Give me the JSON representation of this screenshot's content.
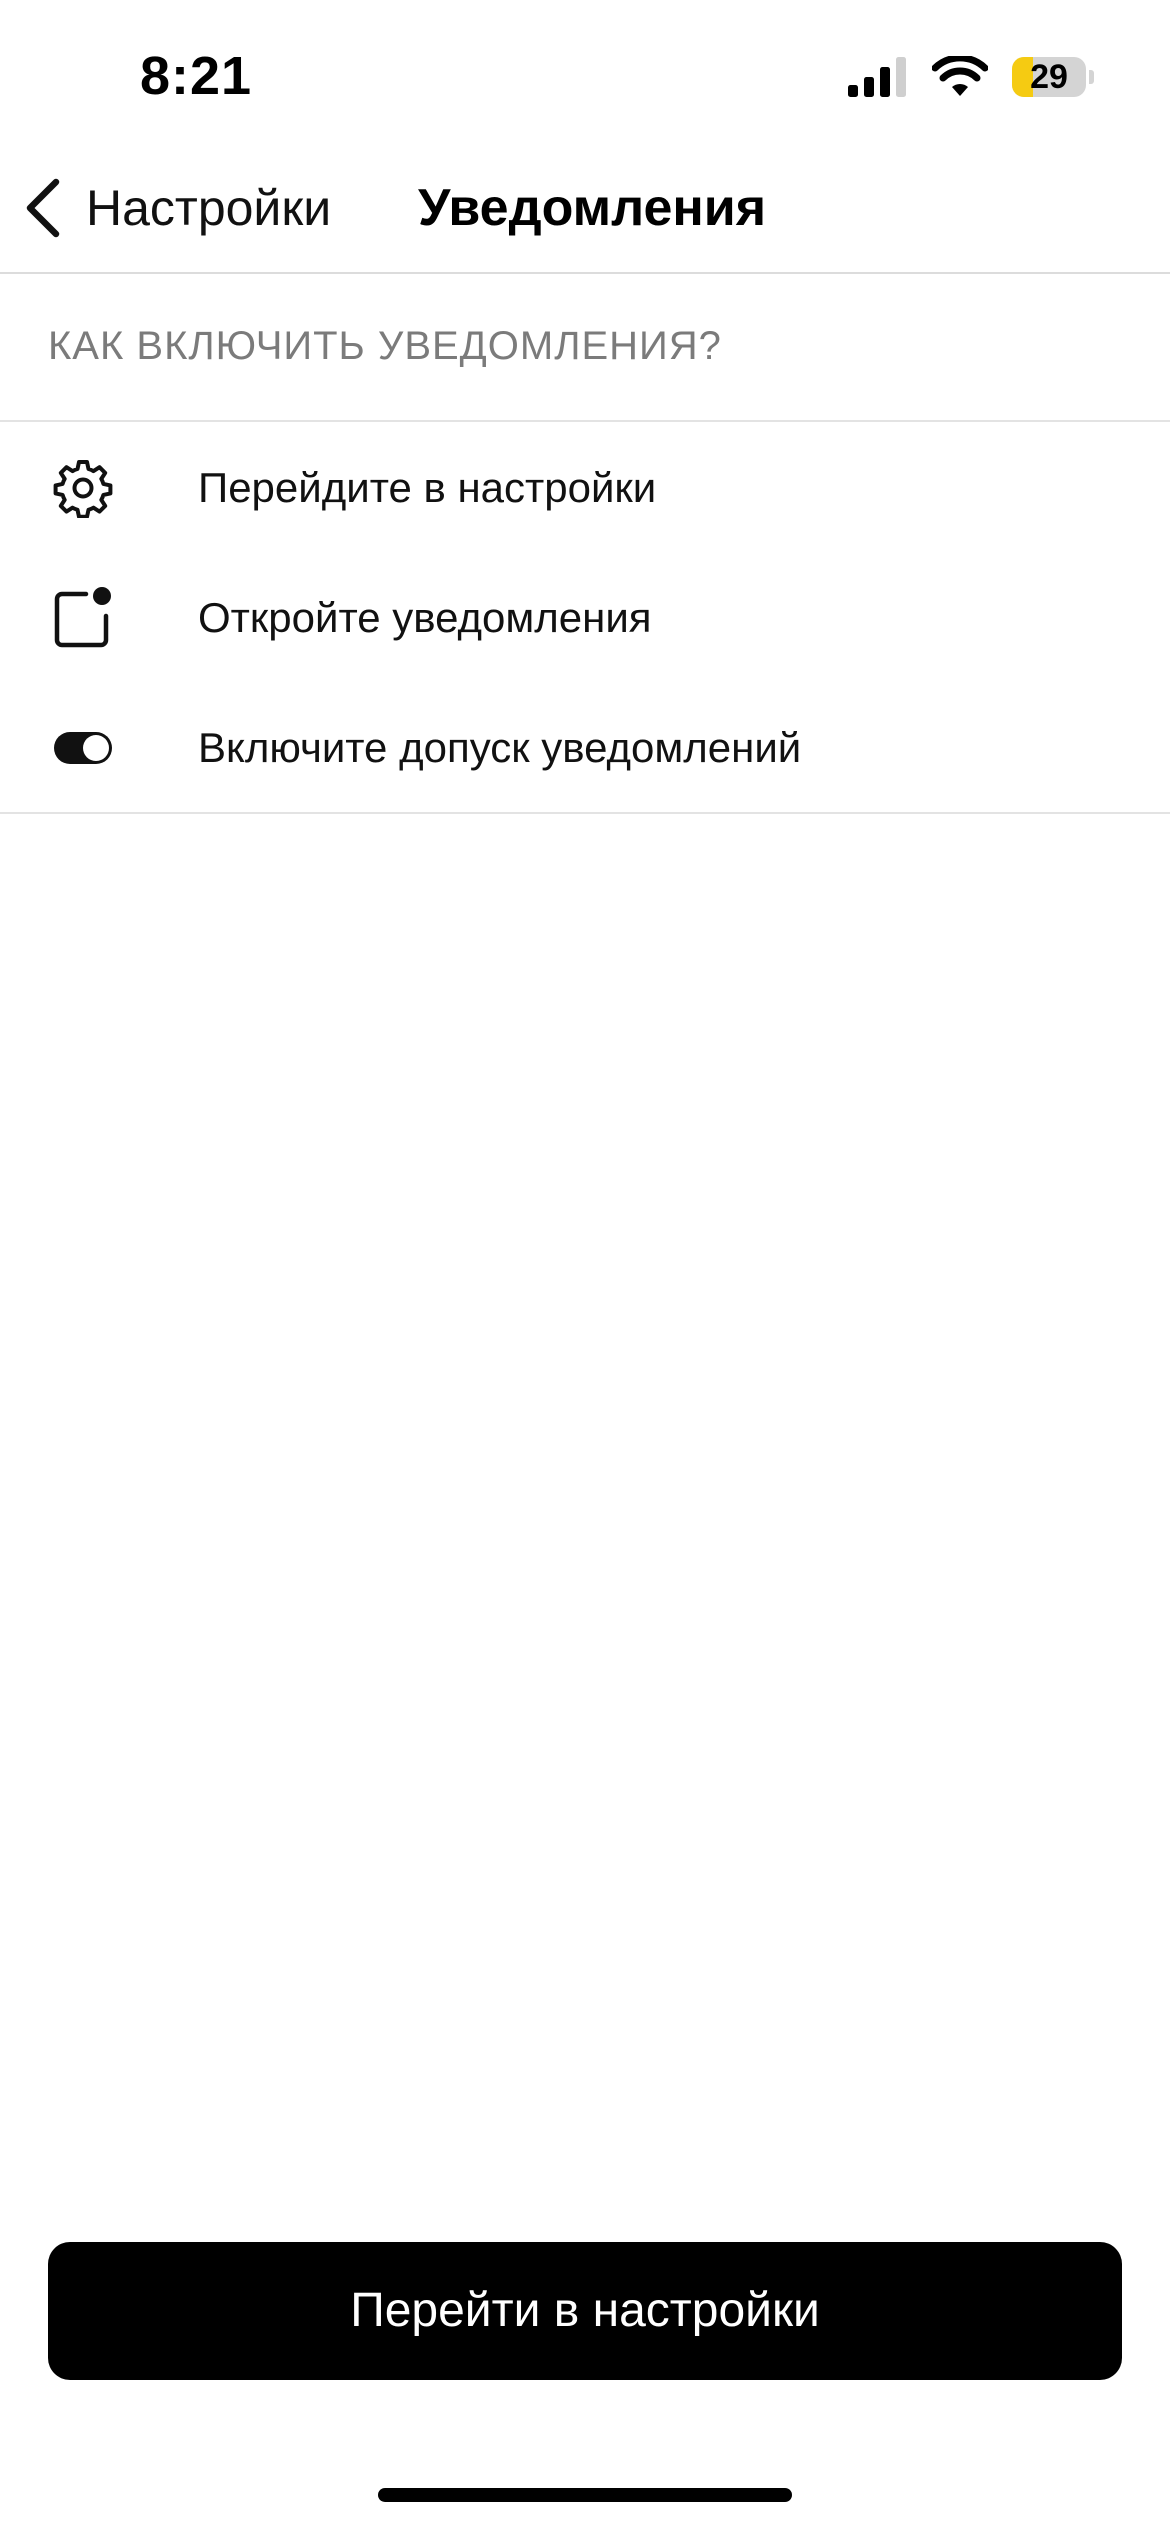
{
  "status_bar": {
    "time": "8:21",
    "battery_level": "29",
    "battery_fraction": 0.29,
    "battery_fill_color": "#f5cb12",
    "icons": [
      "signal-icon",
      "wifi-icon",
      "battery-icon"
    ]
  },
  "nav": {
    "back_label": "Настройки",
    "title": "Уведомления"
  },
  "section": {
    "title": "КАК ВКЛЮЧИТЬ УВЕДОМЛЕНИЯ?"
  },
  "steps": [
    {
      "icon": "gear-icon",
      "label": "Перейдите в настройки"
    },
    {
      "icon": "notification-badge-icon",
      "label": "Откройте уведомления"
    },
    {
      "icon": "toggle-icon",
      "label": "Включите допуск уведомлений"
    }
  ],
  "primary_button": {
    "label": "Перейти в настройки"
  }
}
